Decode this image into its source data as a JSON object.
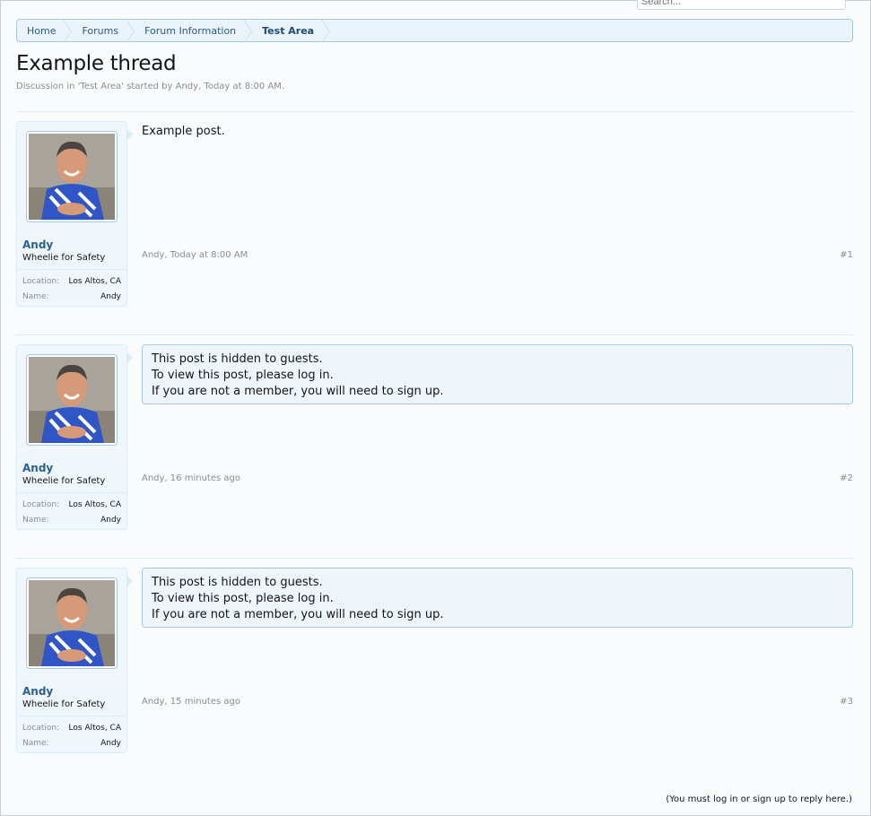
{
  "search": {
    "placeholder": "Search..."
  },
  "breadcrumb": {
    "items": [
      {
        "label": "Home"
      },
      {
        "label": "Forums"
      },
      {
        "label": "Forum Information"
      },
      {
        "label": "Test Area"
      }
    ]
  },
  "thread": {
    "title": "Example thread",
    "description": "Discussion in 'Test Area' started by Andy, Today at 8:00 AM."
  },
  "posts": [
    {
      "author": "Andy",
      "user_title": "Wheelie for Safety",
      "location_label": "Location:",
      "location": "Los Altos, CA",
      "name_label": "Name:",
      "name": "Andy",
      "message": "Example post.",
      "meta": "Andy, Today at 8:00 AM",
      "number": "#1"
    },
    {
      "author": "Andy",
      "user_title": "Wheelie for Safety",
      "location_label": "Location:",
      "location": "Los Altos, CA",
      "name_label": "Name:",
      "name": "Andy",
      "hidden_lines": [
        "This post is hidden to guests.",
        "To view this post, please log in.",
        "If you are not a member, you will need to sign up."
      ],
      "meta": "Andy, 16 minutes ago",
      "number": "#2"
    },
    {
      "author": "Andy",
      "user_title": "Wheelie for Safety",
      "location_label": "Location:",
      "location": "Los Altos, CA",
      "name_label": "Name:",
      "name": "Andy",
      "hidden_lines": [
        "This post is hidden to guests.",
        "To view this post, please log in.",
        "If you are not a member, you will need to sign up."
      ],
      "meta": "Andy, 15 minutes ago",
      "number": "#3"
    }
  ],
  "footer": {
    "reply_note": "(You must log in or sign up to reply here.)"
  }
}
